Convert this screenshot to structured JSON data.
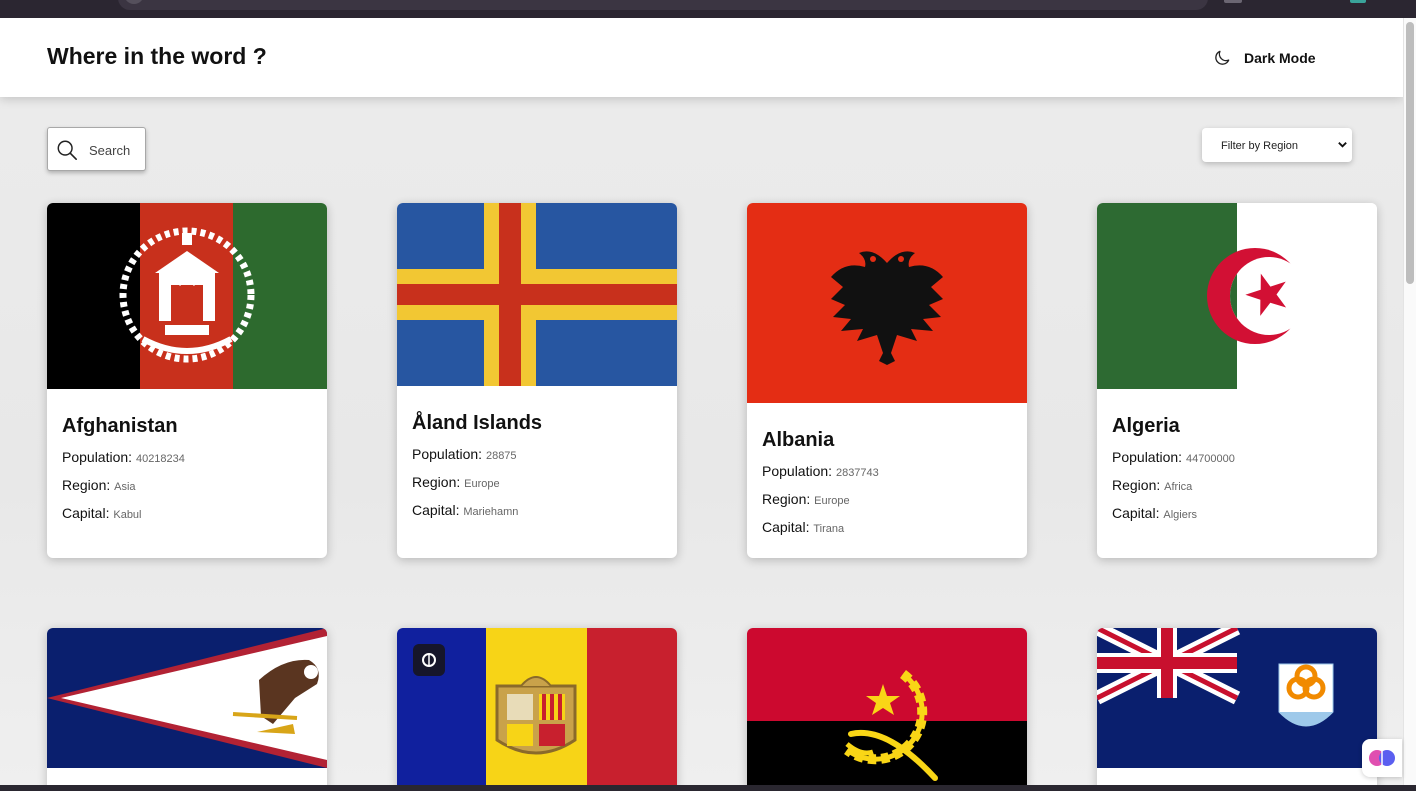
{
  "header": {
    "title": "Where in the word ?",
    "dark_mode_label": "Dark Mode"
  },
  "search": {
    "placeholder": "Search"
  },
  "filter": {
    "selected": "Filter by Region"
  },
  "labels": {
    "population": "Population:",
    "region": "Region:",
    "capital": "Capital:"
  },
  "countries": [
    {
      "name": "Afghanistan",
      "population": "40218234",
      "region": "Asia",
      "capital": "Kabul"
    },
    {
      "name": "Åland Islands",
      "population": "28875",
      "region": "Europe",
      "capital": "Mariehamn"
    },
    {
      "name": "Albania",
      "population": "2837743",
      "region": "Europe",
      "capital": "Tirana"
    },
    {
      "name": "Algeria",
      "population": "44700000",
      "region": "Africa",
      "capital": "Algiers"
    }
  ],
  "colors": {
    "background": "#ececec",
    "card": "#ffffff",
    "text": "#111111",
    "muted": "#666666"
  },
  "icons": {
    "dark_mode": "moon-icon",
    "search": "search-icon",
    "filter": "chevron-down-icon"
  }
}
